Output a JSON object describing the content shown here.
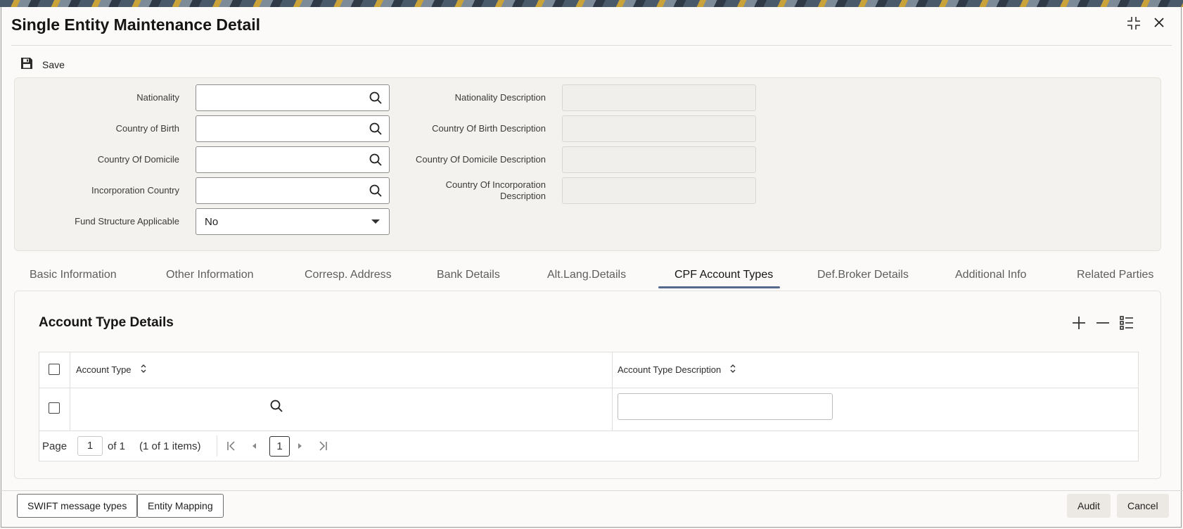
{
  "window": {
    "title": "Single Entity Maintenance Detail"
  },
  "toolbar": {
    "save_label": "Save"
  },
  "form": {
    "nationality_label": "Nationality",
    "nationality_value": "",
    "country_of_birth_label": "Country of Birth",
    "country_of_birth_value": "",
    "country_of_domicile_label": "Country Of Domicile",
    "country_of_domicile_value": "",
    "incorporation_country_label": "Incorporation Country",
    "incorporation_country_value": "",
    "fund_structure_label": "Fund Structure Applicable",
    "fund_structure_value": "No",
    "nationality_desc_label": "Nationality Description",
    "country_of_birth_desc_label": "Country Of Birth Description",
    "country_of_domicile_desc_label": "Country Of Domicile Description",
    "country_of_incorporation_desc_label_1": "Country Of Incorporation",
    "country_of_incorporation_desc_label_2": "Description"
  },
  "tabs": [
    {
      "label": "Basic Information",
      "active": false
    },
    {
      "label": "Other Information",
      "active": false
    },
    {
      "label": "Corresp. Address",
      "active": false
    },
    {
      "label": "Bank Details",
      "active": false
    },
    {
      "label": "Alt.Lang.Details",
      "active": false
    },
    {
      "label": "CPF Account Types",
      "active": true
    },
    {
      "label": "Def.Broker Details",
      "active": false
    },
    {
      "label": "Additional Info",
      "active": false
    },
    {
      "label": "Related Parties",
      "active": false
    }
  ],
  "section": {
    "title": "Account Type Details",
    "columns": [
      "Account Type",
      "Account Type Description"
    ],
    "rows": [
      {
        "account_type": "",
        "account_type_description": ""
      }
    ]
  },
  "pager": {
    "page_label": "Page",
    "page_value": "1",
    "of_label": "of 1",
    "items_label": "(1 of 1 items)",
    "current_page": "1"
  },
  "footer": {
    "swift_label": "SWIFT message types",
    "entity_mapping_label": "Entity Mapping",
    "audit_label": "Audit",
    "cancel_label": "Cancel"
  },
  "colors": {
    "active_tab_underline": "#54698b",
    "panel_bg": "#f4f2ee"
  }
}
